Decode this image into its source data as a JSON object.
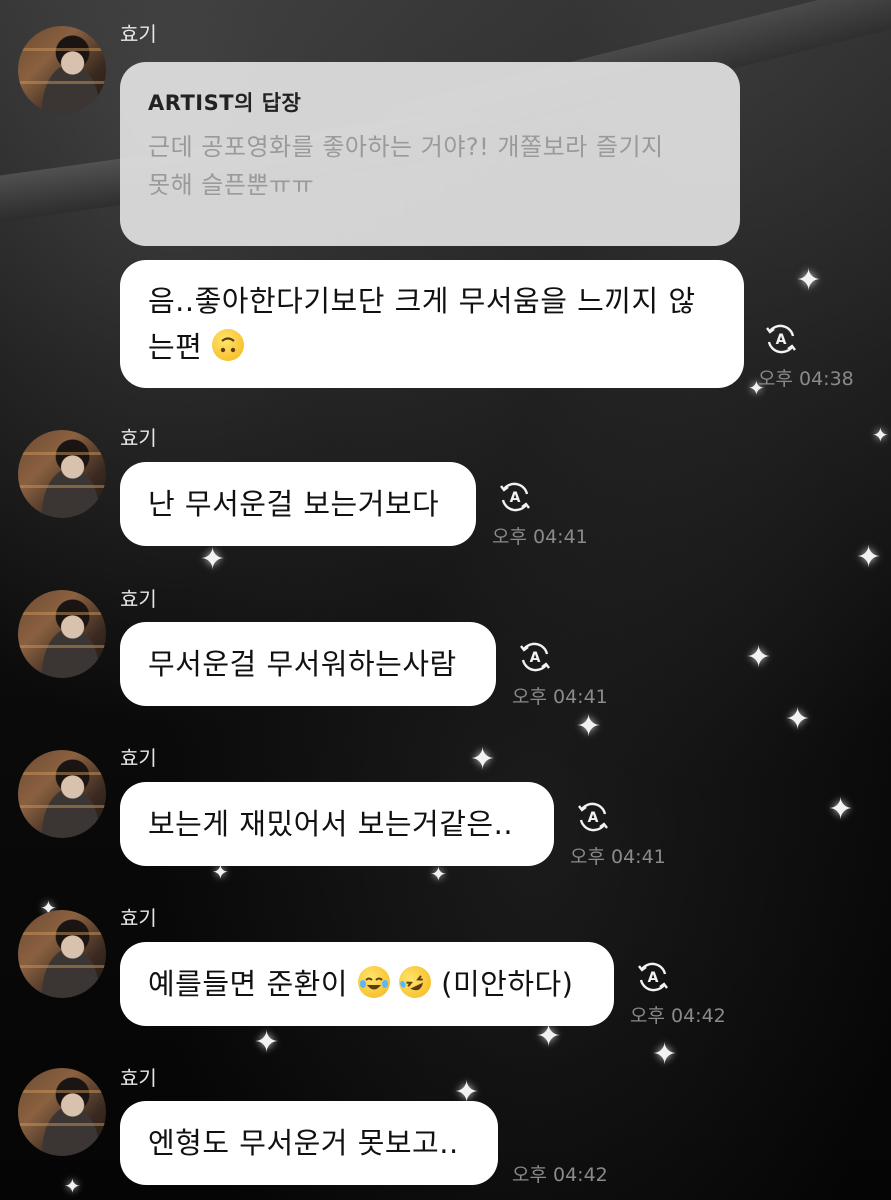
{
  "chat": {
    "sender_name": "효기",
    "reply": {
      "title": "ARTIST의 답장",
      "text_line1": "근데 공포영화를 좋아하는 거야?! 개쫄보라 즐기지",
      "text_line2": "못해 슬픈뿐ㅠㅠ"
    },
    "messages": [
      {
        "line1": "음..좋아한다기보단 크게 무서움을 느끼지 않",
        "line2": "는편",
        "emoji": "upside-down-face",
        "time": "오후 04:38"
      },
      {
        "text": "난 무서운걸 보는거보다",
        "time": "오후 04:41"
      },
      {
        "text": "무서운걸 무서워하는사람",
        "time": "오후 04:41"
      },
      {
        "text": "보는게 재밌어서 보는거같은..",
        "time": "오후 04:41"
      },
      {
        "text_before": "예를들면 준환이",
        "emoji1": "face-with-tears-of-joy",
        "emoji2": "rolling-on-the-floor-laughing",
        "text_after": "(미안하다)",
        "time": "오후 04:42"
      },
      {
        "text": "엔형도 무서운거 못보고..",
        "time": "오후 04:42"
      }
    ]
  },
  "icons": {
    "translate": "auto-translate-icon"
  },
  "colors": {
    "bubble": "#ffffff",
    "reply_bubble": "#e2e2e2",
    "timestamp": "#8a8a8a",
    "sender": "#e6e6e6"
  }
}
